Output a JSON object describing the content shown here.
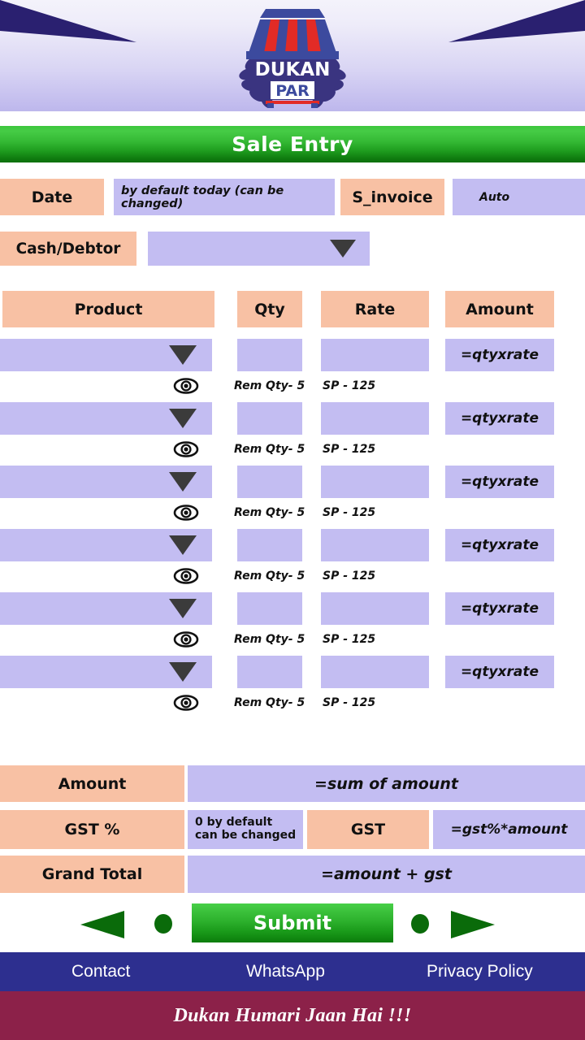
{
  "header": {
    "logo": {
      "name": "dukan-par-logo",
      "brand_top": "DUKAN",
      "brand_bottom": "PAR",
      "awning_blue": "#3c4a9e",
      "awning_red": "#e22b26",
      "leaf_color": "#3a3480"
    },
    "wedge_color": "#2a2070",
    "background_top": "#f4f3fb",
    "background_bottom": "#bdb7ec"
  },
  "banner": {
    "title": "Sale Entry",
    "color_light": "#3cc63c",
    "color_dark": "#0d700d",
    "text_color": "#ffffff"
  },
  "form": {
    "date": {
      "label": "Date",
      "value": "by default today (can be changed)"
    },
    "s_invoice": {
      "label": "S_invoice",
      "value": "Auto"
    },
    "cash_debtor": {
      "label": "Cash/Debtor",
      "value": ""
    }
  },
  "table": {
    "headers": {
      "product": "Product",
      "qty": "Qty",
      "rate": "Rate",
      "amount": "Amount"
    },
    "rows": [
      {
        "product": "",
        "qty": "",
        "rate": "",
        "amount": "=qtyxrate",
        "rem_qty": "Rem Qty- 5",
        "sp": "SP - 125"
      },
      {
        "product": "",
        "qty": "",
        "rate": "",
        "amount": "=qtyxrate",
        "rem_qty": "Rem Qty- 5",
        "sp": "SP - 125"
      },
      {
        "product": "",
        "qty": "",
        "rate": "",
        "amount": "=qtyxrate",
        "rem_qty": "Rem Qty- 5",
        "sp": "SP - 125"
      },
      {
        "product": "",
        "qty": "",
        "rate": "",
        "amount": "=qtyxrate",
        "rem_qty": "Rem Qty- 5",
        "sp": "SP - 125"
      },
      {
        "product": "",
        "qty": "",
        "rate": "",
        "amount": "=qtyxrate",
        "rem_qty": "Rem Qty- 5",
        "sp": "SP - 125"
      },
      {
        "product": "",
        "qty": "",
        "rate": "",
        "amount": "=qtyxrate",
        "rem_qty": "Rem Qty- 5",
        "sp": "SP - 125"
      }
    ]
  },
  "summary": {
    "amount_label": "Amount",
    "amount_value": "=sum of amount",
    "gst_pct_label": "GST %",
    "gst_pct_value": "0 by default\ncan be changed",
    "gst_label": "GST",
    "gst_value": "=gst%*amount",
    "grand_total_label": "Grand Total",
    "grand_total_value": "=amount + gst"
  },
  "actions": {
    "submit_label": "Submit",
    "prev_icon": "arrow-left-icon",
    "next_icon": "arrow-right-icon",
    "arrow_color": "#0a6b0a"
  },
  "footer": {
    "nav": [
      {
        "label": "Contact"
      },
      {
        "label": "WhatsApp"
      },
      {
        "label": "Privacy Policy"
      }
    ],
    "nav_bg": "#2d2f8f",
    "tagline": "Dukan Humari Jaan Hai !!!",
    "tagline_bg": "#8c2149"
  },
  "theme": {
    "peach": "#f8c1a4",
    "lavender": "#c3bdf2",
    "caret": "#3b3b3b"
  }
}
